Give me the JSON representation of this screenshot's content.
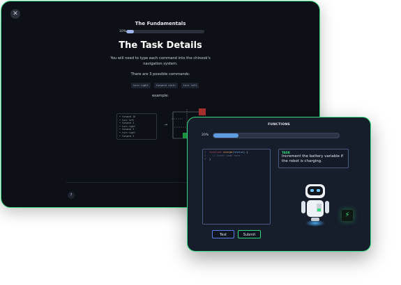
{
  "back_window": {
    "close_icon": "close-icon",
    "title": "The Fundamentals",
    "progress": {
      "label": "10%",
      "value": 0.1
    },
    "heading": "The Task Details",
    "description": "You will need to type each command into the chinook's navigation system.",
    "commands_intro": "There are 3 possible commands:",
    "commands": [
      "turn right",
      "forward <int>",
      "turn left"
    ],
    "example_label": "example:",
    "example_lines": [
      "• forward 10",
      "• turn left",
      "• forward 3",
      "• turn right",
      "• forward 3",
      "• turn right",
      "• forward 5"
    ],
    "help_label": "?"
  },
  "front_window": {
    "title": "FUNCTIONS",
    "progress": {
      "label": "20%",
      "value": 0.2
    },
    "code": {
      "line_numbers": [
        "1",
        "2",
        "3"
      ],
      "keyword": "function",
      "fn_name": "charge",
      "param": "status",
      "open_brace": "{",
      "comment": "// enter code here",
      "close_brace": "}"
    },
    "task": {
      "label": "TASK",
      "text": "Increment the battery variable if the robot is charging."
    },
    "test_label": "Test",
    "submit_label": "Submit",
    "icons": [
      "robot-icon",
      "lightning-bolt-icon"
    ]
  },
  "colors": {
    "accent_green": "#35dc7f",
    "accent_blue": "#5d9ce0",
    "back_bg": "#0d1016",
    "front_bg": "#161d2b"
  }
}
